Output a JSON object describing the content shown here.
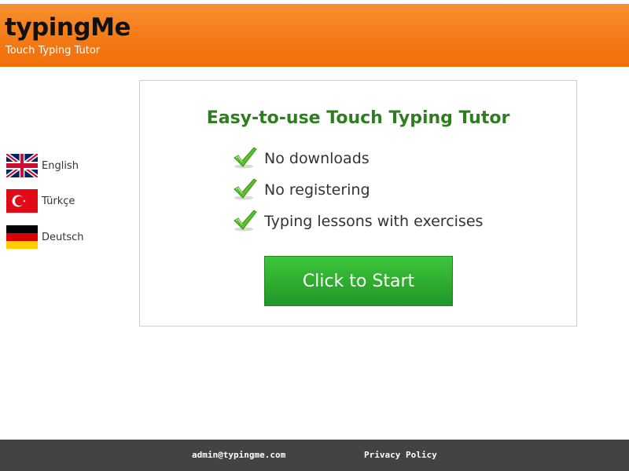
{
  "header": {
    "logo": "typingMe",
    "tagline": "Touch Typing Tutor",
    "background_color": "#f47c18"
  },
  "languages": [
    {
      "label": "English",
      "flag": "uk-flag-icon"
    },
    {
      "label": "Türkçe",
      "flag": "turkey-flag-icon"
    },
    {
      "label": "Deutsch",
      "flag": "germany-flag-icon"
    }
  ],
  "card": {
    "title": "Easy-to-use Touch Typing Tutor",
    "title_color": "#2e7d1e",
    "features": [
      {
        "label": "No downloads",
        "icon": "checkmark-icon"
      },
      {
        "label": "No registering",
        "icon": "checkmark-icon"
      },
      {
        "label": "Typing lessons with exercises",
        "icon": "checkmark-icon"
      }
    ],
    "start_button_label": "Click to Start",
    "start_button_color": "#2fae2f"
  },
  "footer": {
    "email": "admin@typingme.com",
    "privacy_label": "Privacy Policy",
    "background_color": "#434343"
  }
}
